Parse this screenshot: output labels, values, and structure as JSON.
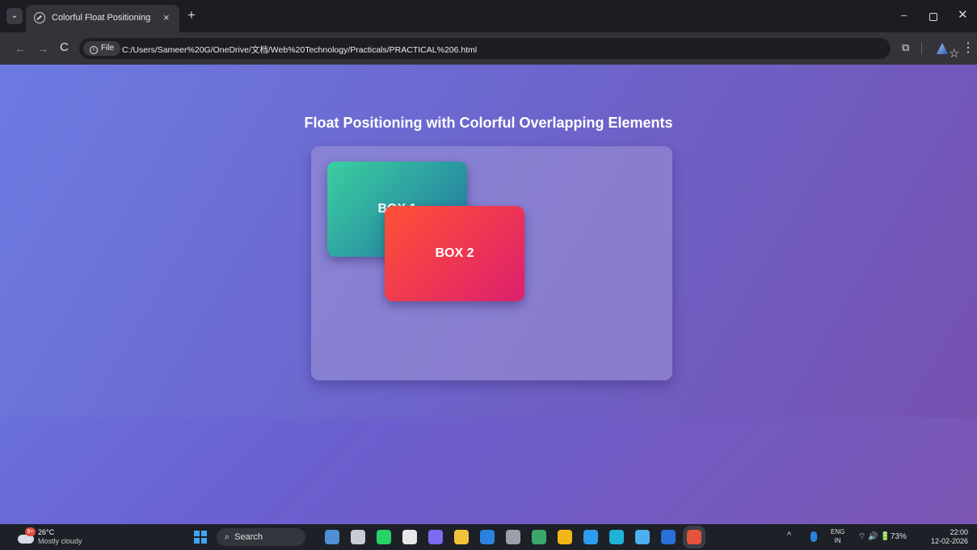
{
  "browser": {
    "tab": {
      "title": "Colorful Float Positioning",
      "close": "×"
    },
    "new_tab": "+",
    "window_controls": {
      "minimize": "–",
      "close": "✕"
    },
    "nav": {
      "back": "←",
      "forward": "→",
      "reload": "C"
    },
    "site_chip": "File",
    "url": "C:/Users/Sameer%20G/OneDrive/文档/Web%20Technology/Practicals/PRACTICAL%206.html",
    "toolbar_icons": {
      "star": "☆",
      "extensions": "⧉",
      "menu": "⋮"
    }
  },
  "page": {
    "heading": "Float Positioning with Colorful Overlapping Elements",
    "boxes": [
      {
        "label": "BOX 1",
        "color_from": "#3bd0a0",
        "color_to": "#1f6fa0"
      },
      {
        "label": "BOX 2",
        "color_from": "#ff5135",
        "color_to": "#dd1f6e"
      }
    ],
    "background_colors": [
      "#6c7be2",
      "#6c66cd",
      "#7551b0"
    ]
  },
  "taskbar": {
    "weather": {
      "badge": "9+",
      "temp": "26°C",
      "desc": "Mostly cloudy"
    },
    "search_label": "Search",
    "pinned_apps": [
      {
        "icon": "people-icon",
        "color": "#4f8fd8"
      },
      {
        "icon": "task-view-icon",
        "color": "#c9ccd6"
      },
      {
        "icon": "whatsapp-icon",
        "color": "#25d366"
      },
      {
        "icon": "chatgpt-icon",
        "color": "#e8e8e8"
      },
      {
        "icon": "copilot-icon",
        "color": "#7c6cf2"
      },
      {
        "icon": "file-explorer-icon",
        "color": "#f3c23c"
      },
      {
        "icon": "bluetooth-icon",
        "color": "#2b82e0"
      },
      {
        "icon": "terminal-icon",
        "color": "#9aa0ab"
      },
      {
        "icon": "photos-icon",
        "color": "#3aa86b"
      },
      {
        "icon": "chrome-icon",
        "color": "#f2b619"
      },
      {
        "icon": "vscode-icon",
        "color": "#2f9bf0"
      },
      {
        "icon": "edge-icon",
        "color": "#1fb2d6"
      },
      {
        "icon": "app-a-icon",
        "color": "#4ab0f2"
      },
      {
        "icon": "word-icon",
        "color": "#2b6fd8"
      },
      {
        "icon": "chrome-active-icon",
        "color": "#e6533c"
      }
    ],
    "tray": {
      "chevron": "^",
      "lang_top": "ENG",
      "lang_bottom": "IN",
      "status": "⌔ 🔊 🔋73%",
      "time": "22:00",
      "date": "12-02-2026"
    }
  }
}
